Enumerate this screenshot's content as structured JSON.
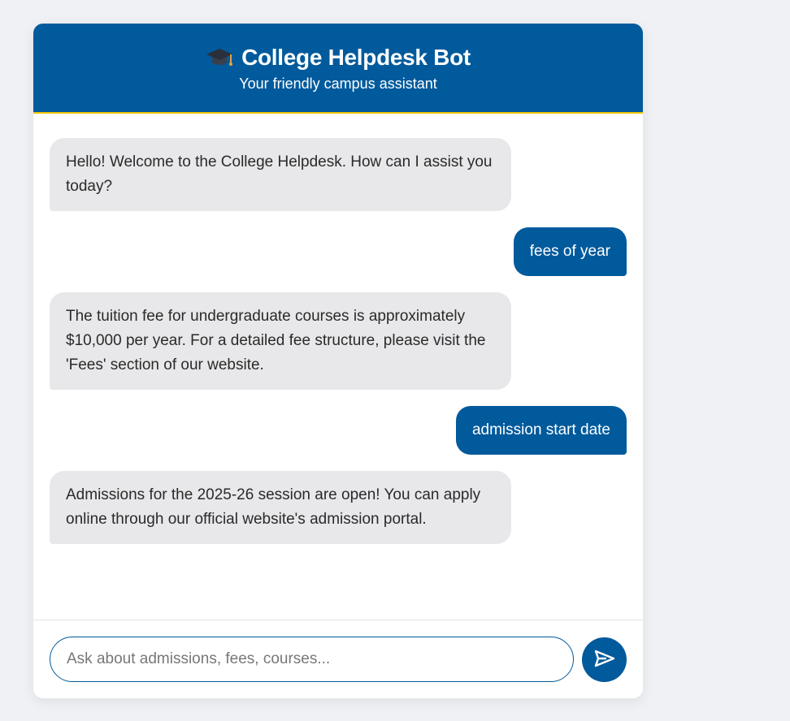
{
  "header": {
    "icon": "graduation-cap-icon",
    "title": "College Helpdesk Bot",
    "subtitle": "Your friendly campus assistant"
  },
  "messages": [
    {
      "sender": "bot",
      "text": "Hello! Welcome to the College Helpdesk. How can I assist you today?"
    },
    {
      "sender": "user",
      "text": "fees of year"
    },
    {
      "sender": "bot",
      "text": "The tuition fee for undergraduate courses is approximately $10,000 per year. For a detailed fee structure, please visit the 'Fees' section of our website."
    },
    {
      "sender": "user",
      "text": "admission start date"
    },
    {
      "sender": "bot",
      "text": "Admissions for the 2025-26 session are open! You can apply online through our official website's admission portal."
    }
  ],
  "input": {
    "value": "",
    "placeholder": "Ask about admissions, fees, courses..."
  },
  "send": {
    "icon": "send-icon"
  },
  "colors": {
    "brand": "#005a9c",
    "accent": "#f2c300",
    "bot_bubble": "#e8e8ea",
    "page_background": "#f0f1f5"
  }
}
